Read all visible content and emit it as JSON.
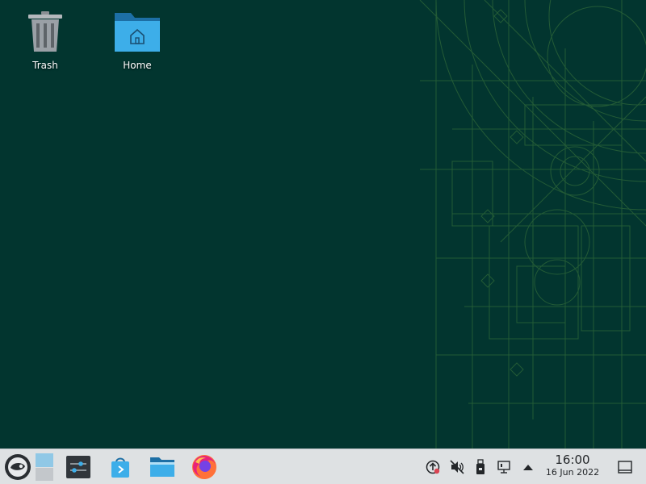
{
  "desktop": {
    "background_color": "#02352f",
    "accent_color": "#73ba25",
    "icons": [
      {
        "label": "Trash",
        "icon": "trash-icon"
      },
      {
        "label": "Home",
        "icon": "home-folder-icon"
      }
    ]
  },
  "taskbar": {
    "launchers": [
      {
        "icon": "opensuse-application-launcher-icon"
      },
      {
        "icon": "pager-icon"
      },
      {
        "icon": "system-settings-icon"
      },
      {
        "icon": "discover-software-center-icon"
      },
      {
        "icon": "dolphin-file-manager-icon"
      },
      {
        "icon": "firefox-icon"
      }
    ],
    "tray": [
      {
        "icon": "updates-icon"
      },
      {
        "icon": "volume-muted-icon"
      },
      {
        "icon": "removable-device-icon"
      },
      {
        "icon": "network-wired-icon"
      },
      {
        "icon": "expand-tray-arrow-icon"
      }
    ],
    "clock": {
      "time": "16:00",
      "date": "16 Jun 2022"
    },
    "show_desktop_icon": "show-desktop-icon"
  }
}
